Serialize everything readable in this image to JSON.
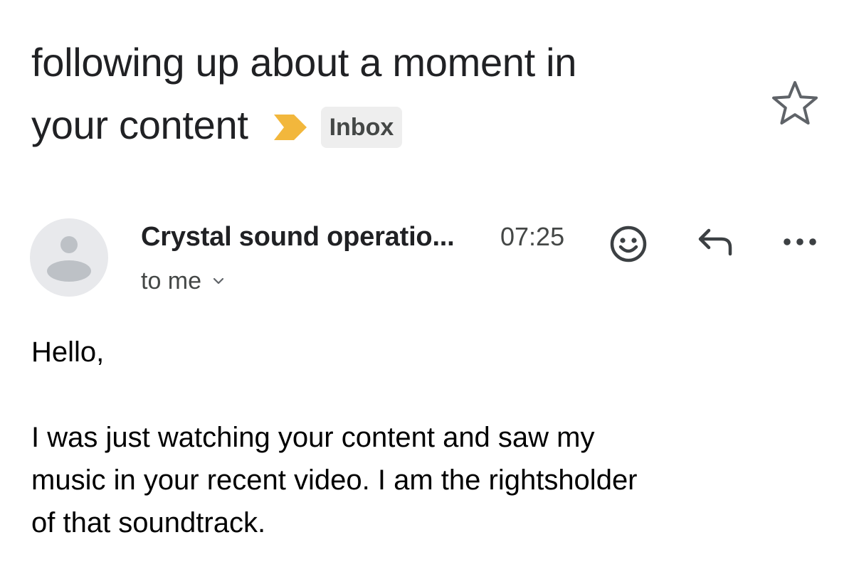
{
  "subject": {
    "line1": "following up about a moment in",
    "line2": "your content",
    "label": "Inbox"
  },
  "message": {
    "sender": "Crystal sound operatio...",
    "time": "07:25",
    "recipient": "to me",
    "greeting": "Hello,",
    "body_lines": [
      "I was just watching your content and saw my",
      "music in your recent video. I am the rightsholder",
      "of that soundtrack."
    ]
  },
  "icons": {
    "importance": "importance-marker-icon",
    "star": "star-icon",
    "avatar": "person-avatar-icon",
    "emoji": "emoji-reaction-icon",
    "reply": "reply-icon",
    "more": "more-options-icon",
    "chevron": "chevron-down-icon"
  },
  "colors": {
    "importance_marker": "#F2B73C",
    "label_chip_bg": "#EEEEEE",
    "avatar_bg": "#E8E9EC",
    "avatar_fg": "#BDC1C6"
  }
}
